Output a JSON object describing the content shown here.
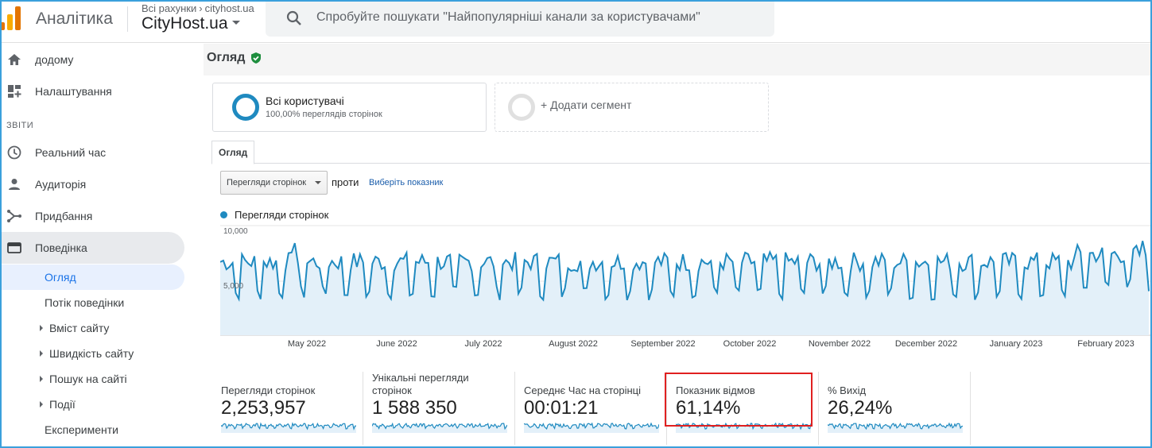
{
  "app": {
    "title": "Аналітика",
    "breadcrumb_all": "Всі рахунки",
    "breadcrumb_site": "cityhost.ua",
    "account": "CityHost.ua",
    "search_placeholder": "Спробуйте пошукати \"Найпопулярніші канали за користувачами\""
  },
  "sidebar": {
    "top_items": [
      {
        "label": "додому",
        "icon": "home-icon"
      },
      {
        "label": "Налаштування",
        "icon": "dashboard-icon"
      }
    ],
    "section": "ЗВІТИ",
    "report_items": [
      {
        "label": "Реальний час",
        "icon": "clock-icon"
      },
      {
        "label": "Аудиторія",
        "icon": "person-icon"
      },
      {
        "label": "Придбання",
        "icon": "acquisition-icon"
      },
      {
        "label": "Поведінка",
        "icon": "behavior-icon",
        "active": true
      }
    ],
    "behavior_sub": [
      {
        "label": "Огляд",
        "selected": true,
        "expandable": false
      },
      {
        "label": "Потік поведінки",
        "expandable": false
      },
      {
        "label": "Вміст сайту",
        "expandable": true
      },
      {
        "label": "Швидкість сайту",
        "expandable": true
      },
      {
        "label": "Пошук на сайті",
        "expandable": true
      },
      {
        "label": "Події",
        "expandable": true
      },
      {
        "label": "Експерименти",
        "expandable": false
      }
    ]
  },
  "main": {
    "page_title": "Огляд",
    "segments": {
      "all_users_title": "Всі користувачі",
      "all_users_sub": "100,00% переглядів сторінок",
      "add_segment": "+ Додати сегмент"
    },
    "tab": "Огляд",
    "metric_select": "Перегляди сторінок",
    "vs_label": "проти",
    "pick_metric": "Виберіть показник",
    "legend": "Перегляди сторінок"
  },
  "chart_data": {
    "type": "area",
    "series": [
      {
        "name": "Перегляди сторінок",
        "color": "#1f8ac0"
      }
    ],
    "y_ticks": [
      "10,000",
      "5,000"
    ],
    "ylim": [
      0,
      10000
    ],
    "x_labels": [
      "May 2022",
      "June 2022",
      "July 2022",
      "August 2022",
      "September 2022",
      "October 2022",
      "November 2022",
      "December 2022",
      "January 2023",
      "February 2023"
    ],
    "grid": true
  },
  "cards": [
    {
      "title": "Перегляди сторінок",
      "value": "2,253,957"
    },
    {
      "title": "Унікальні перегляди сторінок",
      "value": "1 588 350"
    },
    {
      "title": "Середнє Час на сторінці",
      "value": "00:01:21"
    },
    {
      "title": "Показник відмов",
      "value": "61,14%",
      "highlighted": true
    },
    {
      "title": "% Вихід",
      "value": "26,24%"
    }
  ],
  "colors": {
    "accent": "#1f8ac0",
    "fill": "#e3f0f9",
    "highlight": "#e02020",
    "verified": "#1e8e3e"
  }
}
